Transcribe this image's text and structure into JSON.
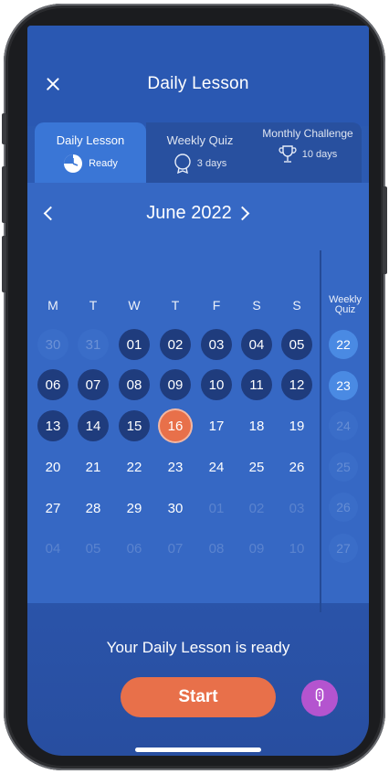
{
  "header": {
    "title": "Daily Lesson"
  },
  "tabs": [
    {
      "label": "Daily Lesson",
      "sub": "Ready",
      "icon": "clock-icon"
    },
    {
      "label": "Weekly Quiz",
      "sub": "3 days",
      "icon": "medal-icon"
    },
    {
      "label": "Monthly Challenge",
      "sub": "10 days",
      "icon": "trophy-icon"
    }
  ],
  "calendar": {
    "month": "June 2022",
    "weekdays": [
      "M",
      "T",
      "W",
      "T",
      "F",
      "S",
      "S"
    ],
    "weeks": [
      [
        {
          "d": "30",
          "s": "faded"
        },
        {
          "d": "31",
          "s": "faded"
        },
        {
          "d": "01",
          "s": "done"
        },
        {
          "d": "02",
          "s": "done"
        },
        {
          "d": "03",
          "s": "done"
        },
        {
          "d": "04",
          "s": "done"
        },
        {
          "d": "05",
          "s": "done"
        }
      ],
      [
        {
          "d": "06",
          "s": "done"
        },
        {
          "d": "07",
          "s": "done"
        },
        {
          "d": "08",
          "s": "done"
        },
        {
          "d": "09",
          "s": "done"
        },
        {
          "d": "10",
          "s": "done"
        },
        {
          "d": "11",
          "s": "done"
        },
        {
          "d": "12",
          "s": "done"
        }
      ],
      [
        {
          "d": "13",
          "s": "done"
        },
        {
          "d": "14",
          "s": "done"
        },
        {
          "d": "15",
          "s": "done"
        },
        {
          "d": "16",
          "s": "today"
        },
        {
          "d": "17",
          "s": "plain"
        },
        {
          "d": "18",
          "s": "plain"
        },
        {
          "d": "19",
          "s": "plain"
        }
      ],
      [
        {
          "d": "20",
          "s": "plain"
        },
        {
          "d": "21",
          "s": "plain"
        },
        {
          "d": "22",
          "s": "plain"
        },
        {
          "d": "23",
          "s": "plain"
        },
        {
          "d": "24",
          "s": "plain"
        },
        {
          "d": "25",
          "s": "plain"
        },
        {
          "d": "26",
          "s": "plain"
        }
      ],
      [
        {
          "d": "27",
          "s": "plain"
        },
        {
          "d": "28",
          "s": "plain"
        },
        {
          "d": "29",
          "s": "plain"
        },
        {
          "d": "30",
          "s": "plain"
        },
        {
          "d": "01",
          "s": "ghost"
        },
        {
          "d": "02",
          "s": "ghost"
        },
        {
          "d": "03",
          "s": "ghost"
        }
      ],
      [
        {
          "d": "04",
          "s": "ghost"
        },
        {
          "d": "05",
          "s": "ghost"
        },
        {
          "d": "06",
          "s": "ghost"
        },
        {
          "d": "07",
          "s": "ghost"
        },
        {
          "d": "08",
          "s": "ghost"
        },
        {
          "d": "09",
          "s": "ghost"
        },
        {
          "d": "10",
          "s": "ghost"
        }
      ]
    ]
  },
  "weekly_quiz": {
    "header": "Weekly Quiz",
    "items": [
      {
        "d": "22",
        "s": "on"
      },
      {
        "d": "23",
        "s": "on"
      },
      {
        "d": "24",
        "s": "off"
      },
      {
        "d": "25",
        "s": "off"
      },
      {
        "d": "26",
        "s": "off"
      },
      {
        "d": "27",
        "s": "off"
      }
    ]
  },
  "footer": {
    "message": "Your Daily Lesson is ready",
    "start_label": "Start",
    "mic_icon": "microphone-icon"
  },
  "colors": {
    "background": "#2b5bb3",
    "accent": "#e8704a",
    "completed_day": "#1f3c7d",
    "mic": "#b454cf"
  }
}
